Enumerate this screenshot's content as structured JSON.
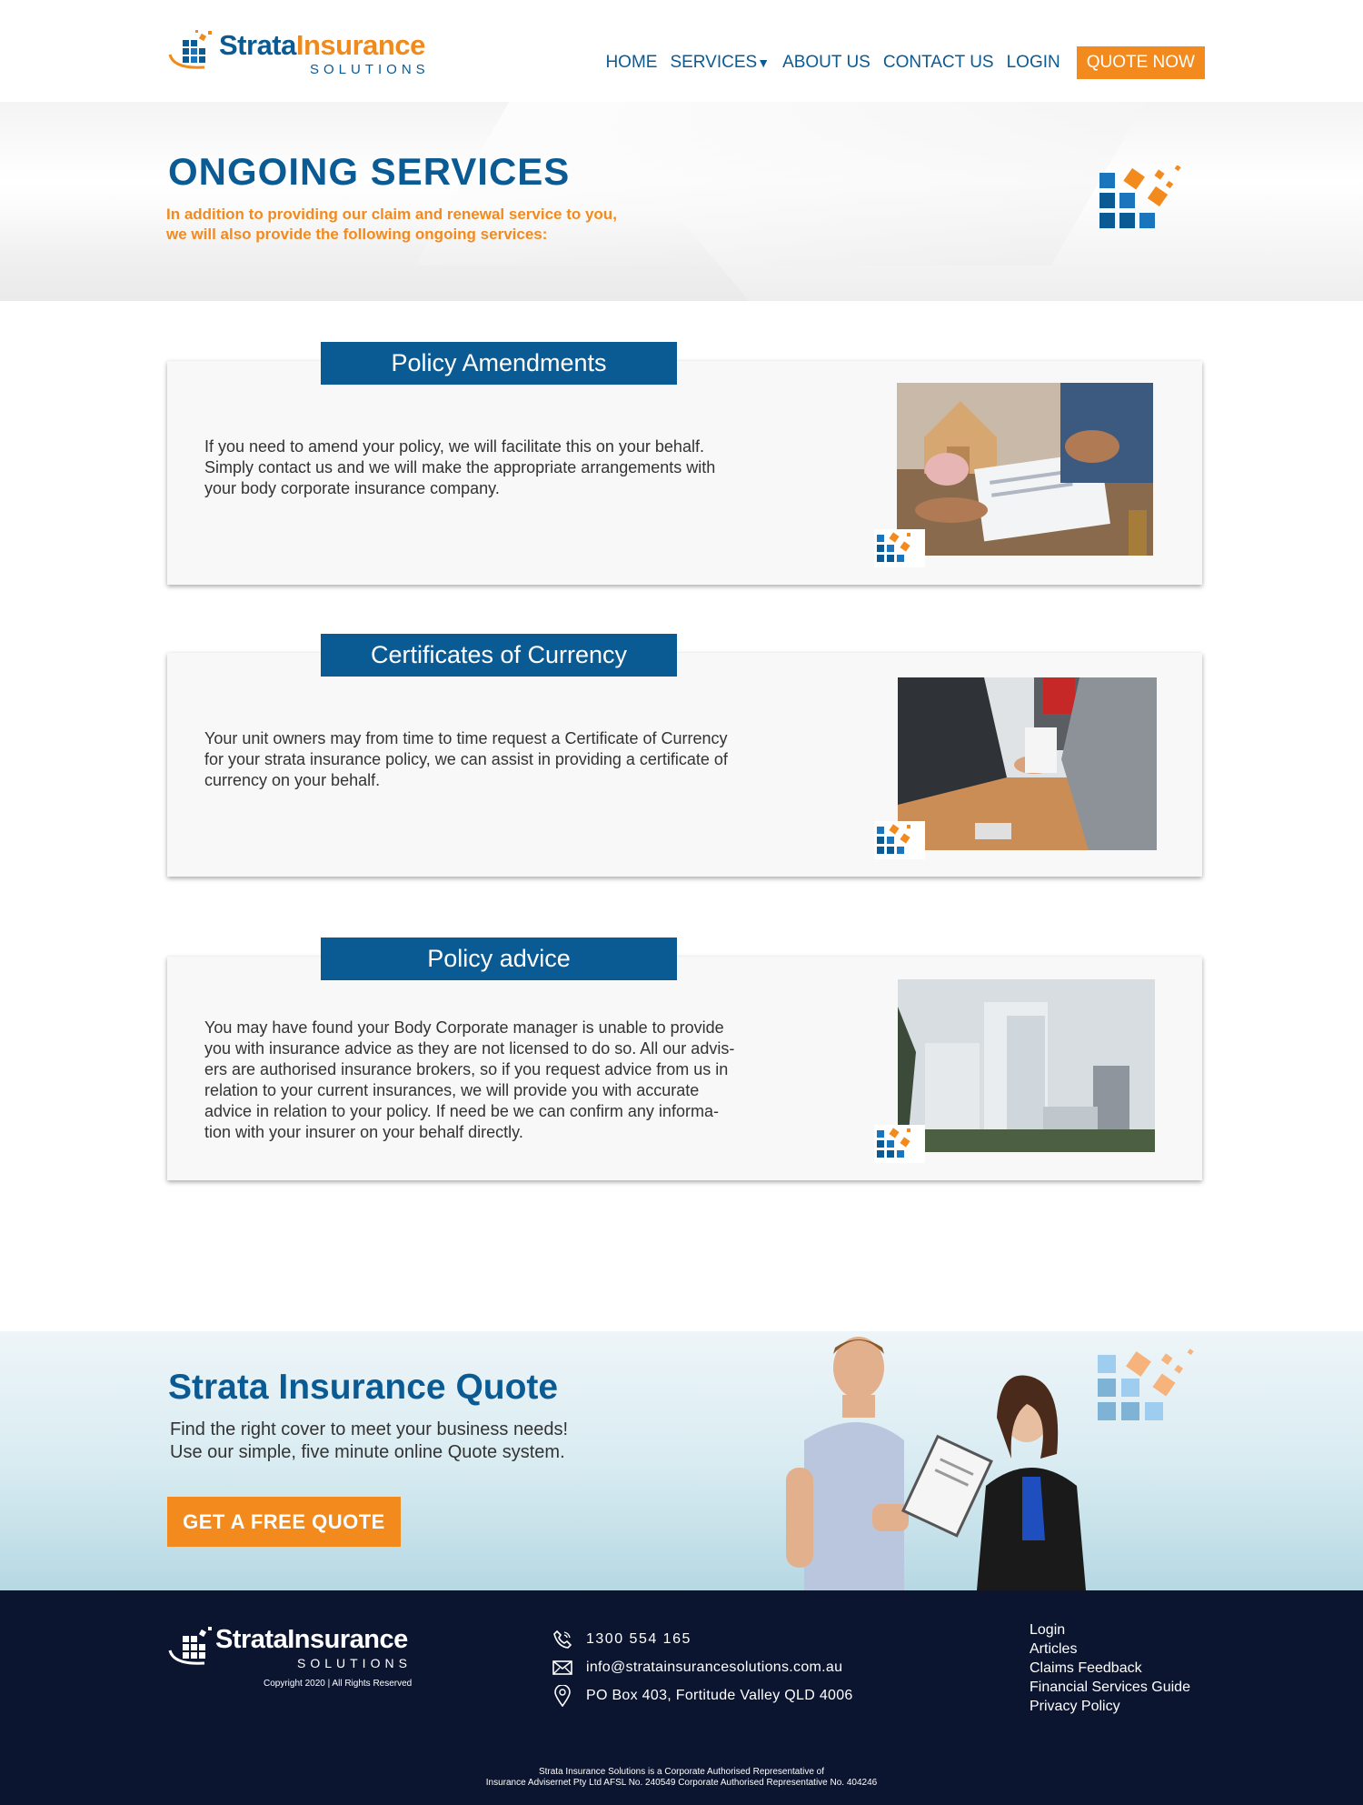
{
  "brand": {
    "name_part1": "Strata",
    "name_part2": "Insurance",
    "tagline": "SOLUTIONS",
    "colors": {
      "primary": "#0a5a94",
      "accent": "#f28a1e",
      "footer_bg": "#0b1530"
    }
  },
  "nav": {
    "items": [
      {
        "label": "HOME"
      },
      {
        "label": "SERVICES",
        "has_dropdown": true,
        "dropdown_icon": "caret-down-icon"
      },
      {
        "label": "ABOUT US"
      },
      {
        "label": "CONTACT US"
      },
      {
        "label": "LOGIN"
      }
    ],
    "cta": "QUOTE NOW"
  },
  "hero": {
    "title": "ONGOING SERVICES",
    "subtitle_line1": "In addition to providing our claim and renewal service to you,",
    "subtitle_line2": "we will also provide the following ongoing services:"
  },
  "services": [
    {
      "title": "Policy Amendments",
      "lines": [
        "If you need to amend your policy, we will facilitate this on your behalf.",
        "Simply contact us and we will make the appropriate arrangements with",
        "your body corporate insurance company."
      ],
      "image": "signing-documents-photo"
    },
    {
      "title": "Certificates of Currency",
      "lines": [
        "Your unit owners may from time to time request a Certificate of Currency",
        "for your strata insurance policy, we can assist in providing a certificate of",
        "currency on your behalf."
      ],
      "image": "handshake-photo"
    },
    {
      "title": "Policy advice",
      "lines": [
        "You may have found your Body Corporate manager is unable to provide",
        "you with insurance advice as they are not licensed to do so. All our advis-",
        "ers are authorised insurance brokers, so if you request advice from us in",
        "relation to your current insurances, we will provide you with accurate",
        "advice in relation to your policy. If need be we can confirm any informa-",
        "tion with your insurer on your behalf directly."
      ],
      "image": "apartment-buildings-photo"
    }
  ],
  "quote_section": {
    "title": "Strata Insurance Quote",
    "line1": "Find the right cover to meet  your business needs!",
    "line2": "Use our simple, five minute online Quote system.",
    "cta": "GET A FREE QUOTE"
  },
  "footer": {
    "copyright": "Copyright 2020 | All Rights Reserved",
    "phone": "1300 554 165",
    "email": "info@stratainsurancesolutions.com.au",
    "address": "PO Box 403, Fortitude Valley QLD 4006",
    "links": [
      "Login",
      "Articles",
      "Claims Feedback",
      "Financial Services Guide",
      "Privacy Policy"
    ],
    "legal_line1": "Strata Insurance Solutions is a Corporate Authorised Representative of",
    "legal_line2": "Insurance Advisernet Pty Ltd AFSL No. 240549  Corporate Authorised Representative No. 404246"
  }
}
